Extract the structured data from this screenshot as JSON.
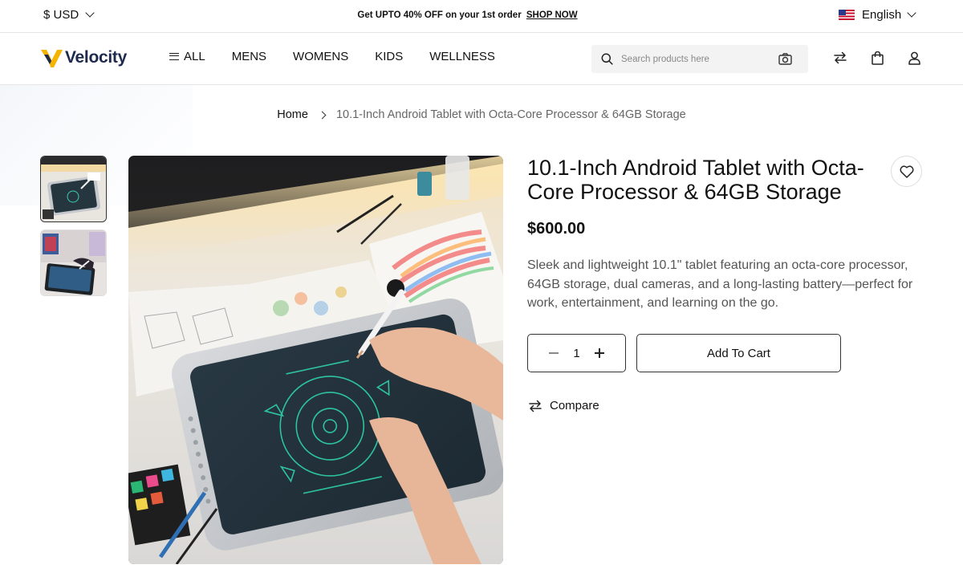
{
  "topbar": {
    "currency": "$ USD",
    "promo_text": "Get UPTO 40% OFF on your 1st order",
    "promo_link": "SHOP NOW",
    "language": "English"
  },
  "header": {
    "brand": "Velocity",
    "nav": [
      "ALL",
      "MENS",
      "WOMENS",
      "KIDS",
      "WELLNESS"
    ],
    "search_placeholder": "Search products here"
  },
  "breadcrumb": {
    "home": "Home",
    "current": "10.1-Inch Android Tablet with Octa-Core Processor & 64GB Storage"
  },
  "product": {
    "title": "10.1-Inch Android Tablet with Octa-Core Processor & 64GB Storage",
    "price": "$600.00",
    "description": "Sleek and lightweight 10.1\" tablet featuring an octa-core processor, 64GB storage, dual cameras, and a long-lasting battery—perfect for work, entertainment, and learning on the go.",
    "quantity": "1",
    "add_to_cart": "Add To Cart",
    "compare": "Compare"
  },
  "colors": {
    "brand_navy": "#1d2a4d",
    "brand_yellow": "#f5b400",
    "text": "#111111",
    "muted": "#555555"
  },
  "icons": {
    "currency_toggle": "chevron-down-icon",
    "language_flag": "us-flag-icon",
    "search": "search-icon",
    "camera": "camera-icon",
    "compare": "compare-arrows-icon",
    "bag": "shopping-bag-icon",
    "account": "user-icon",
    "wishlist": "heart-icon"
  }
}
